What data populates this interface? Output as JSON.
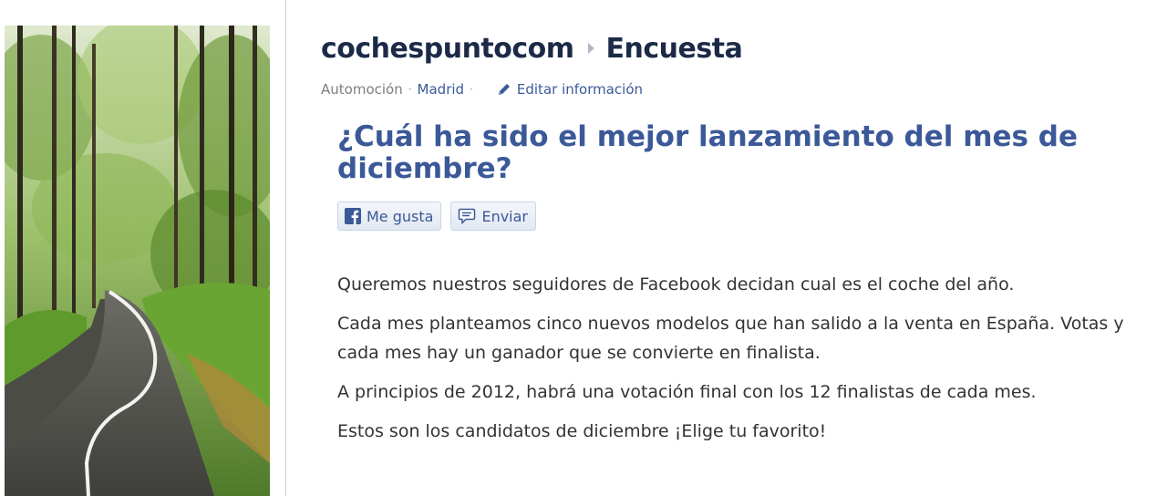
{
  "header": {
    "page_name": "cochespuntocom",
    "section": "Encuesta"
  },
  "meta": {
    "category": "Automoción",
    "location": "Madrid",
    "edit_label": "Editar información"
  },
  "question": "¿Cuál ha sido el mejor lanzamiento del mes de diciembre?",
  "buttons": {
    "like_label": "Me gusta",
    "send_label": "Enviar"
  },
  "paragraphs": [
    "Queremos nuestros seguidores de Facebook decidan cual es el coche del año.",
    "Cada mes planteamos cinco nuevos modelos que han salido a la venta en España. Votas y cada mes hay un ganador que se convierte en finalista.",
    "A principios de 2012, habrá una votación final con los 12 finalistas de cada mes.",
    "Estos son los candidatos de diciembre ¡Elige tu favorito!"
  ],
  "colors": {
    "brand_blue": "#3b5998",
    "title_dark": "#1c2a47",
    "body_text": "#333333"
  },
  "icons": {
    "photo": "forest-road-image",
    "edit": "pencil-icon",
    "like": "facebook-f-icon",
    "send": "speech-bubble-icon",
    "separator": "breadcrumb-arrow-icon"
  }
}
